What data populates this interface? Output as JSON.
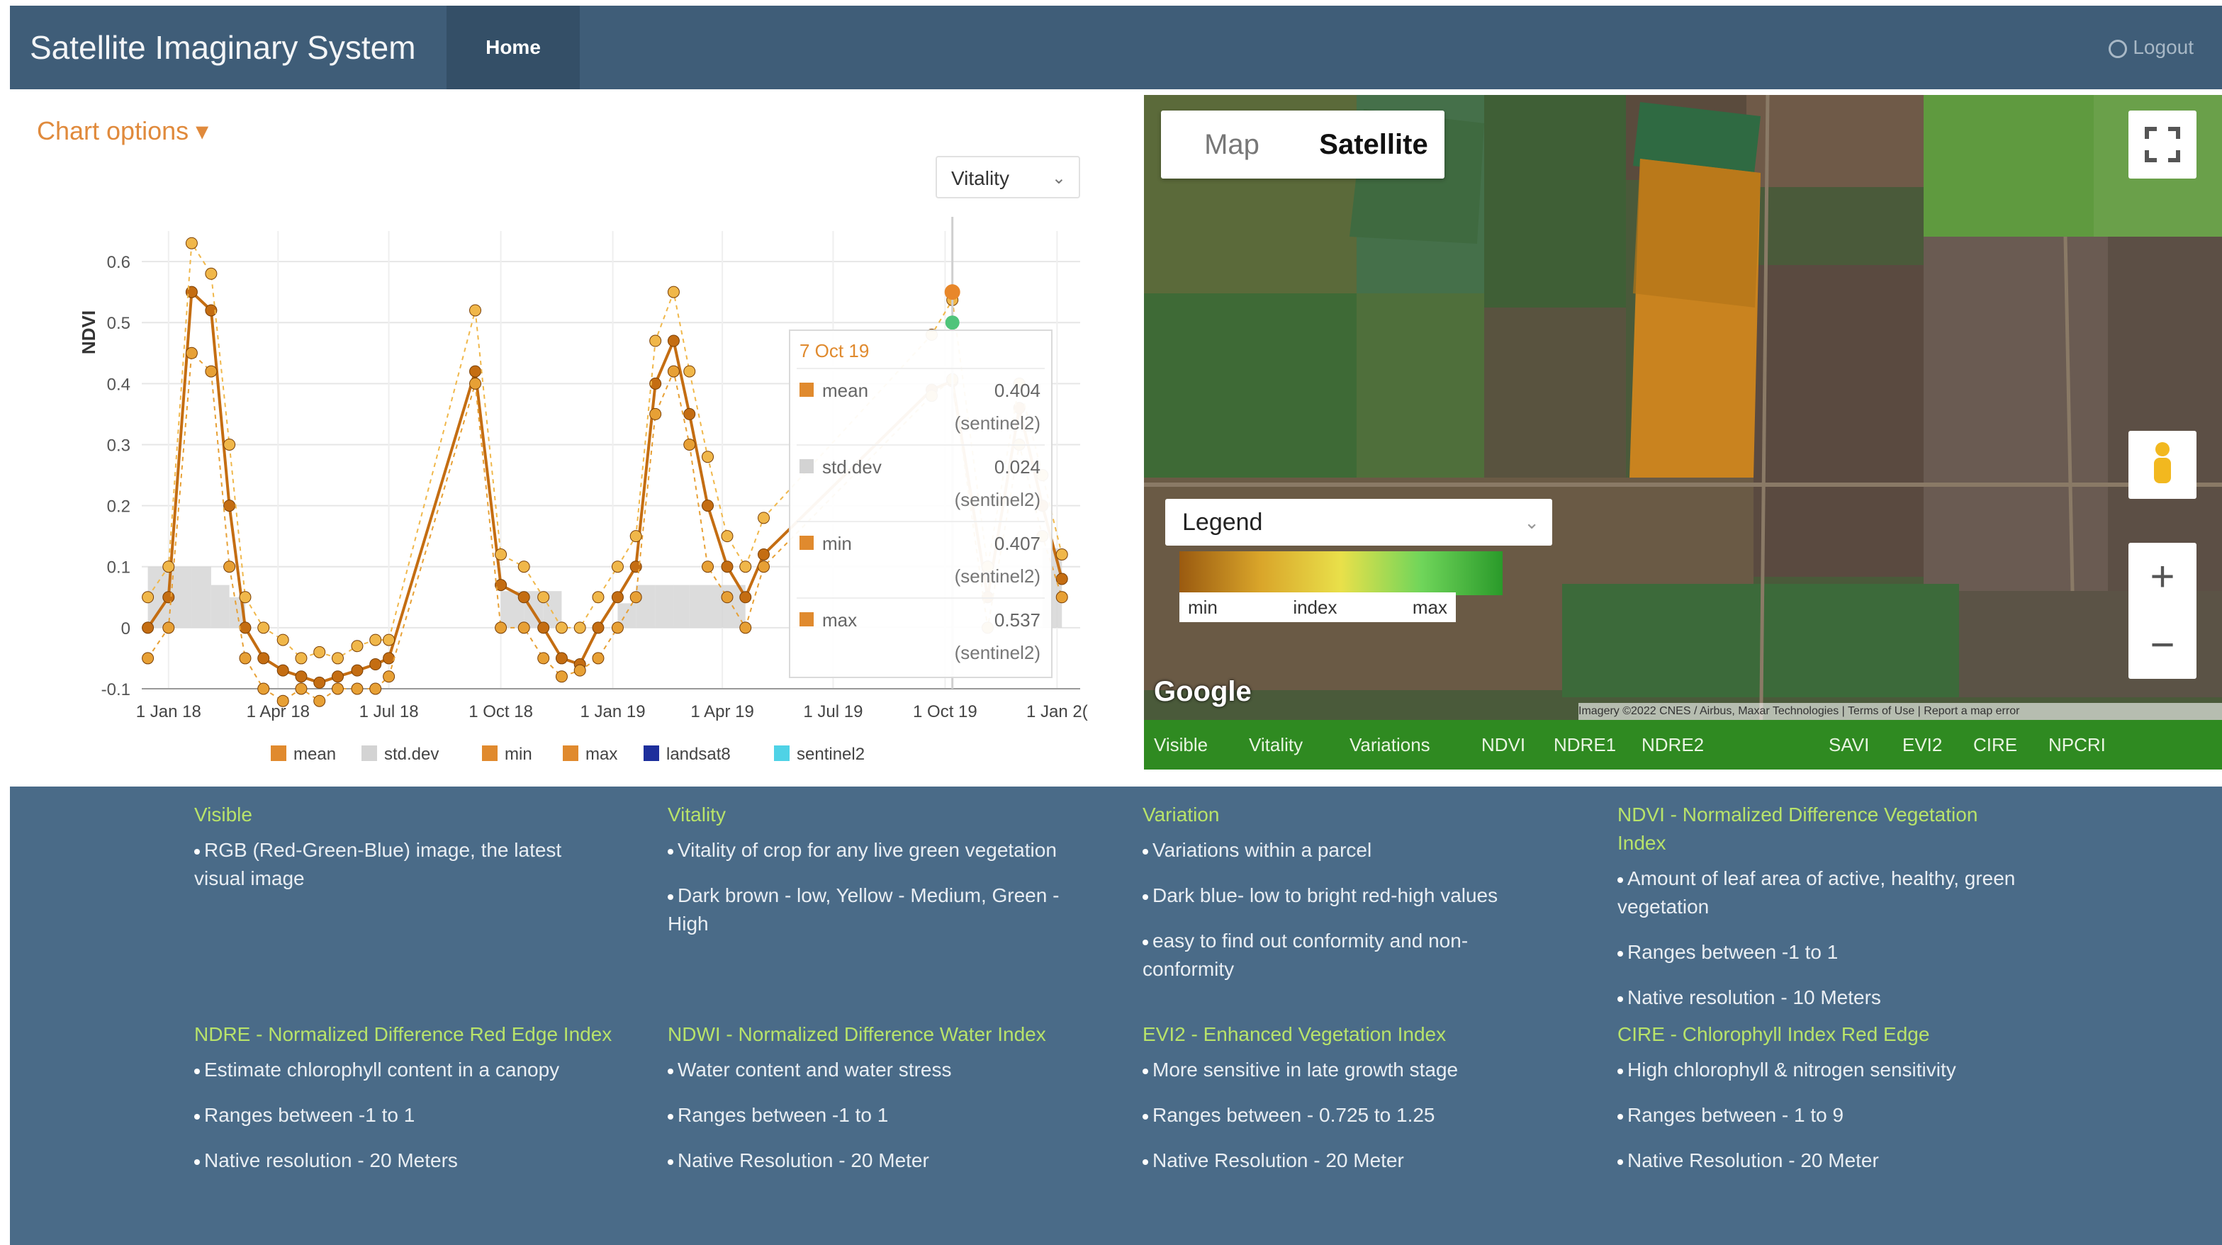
{
  "nav": {
    "brand": "Satellite Imaginary System",
    "home": "Home",
    "logout": "Logout"
  },
  "chart_panel": {
    "options_label": "Chart options ▾",
    "index_select": "Vitality"
  },
  "chart_data": {
    "type": "line",
    "ylabel": "NDVI",
    "yticks": [
      "0.6",
      "0.5",
      "0.4",
      "0.3",
      "0.2",
      "0.1",
      "0",
      "-0.1"
    ],
    "ylim": [
      -0.1,
      0.65
    ],
    "xticks": [
      "1 Jan 18",
      "1 Apr 18",
      "1 Jul 18",
      "1 Oct 18",
      "1 Jan 19",
      "1 Apr 19",
      "1 Jul 19",
      "1 Oct 19",
      "1 Jan 2("
    ],
    "x": [
      "2017-12-15",
      "2018-01-01",
      "2018-01-20",
      "2018-02-05",
      "2018-02-20",
      "2018-03-05",
      "2018-03-20",
      "2018-04-05",
      "2018-04-20",
      "2018-05-05",
      "2018-05-20",
      "2018-06-05",
      "2018-06-20",
      "2018-07-01",
      "2018-09-10",
      "2018-10-01",
      "2018-10-20",
      "2018-11-05",
      "2018-11-20",
      "2018-12-05",
      "2018-12-20",
      "2019-01-05",
      "2019-01-20",
      "2019-02-05",
      "2019-02-20",
      "2019-03-05",
      "2019-03-20",
      "2019-04-05",
      "2019-04-20",
      "2019-05-05",
      "2019-09-20",
      "2019-10-07",
      "2019-11-05",
      "2019-12-01",
      "2019-12-20",
      "2020-01-05"
    ],
    "series": [
      {
        "name": "mean",
        "values": [
          0.0,
          0.05,
          0.55,
          0.52,
          0.2,
          0.0,
          -0.05,
          -0.07,
          -0.08,
          -0.09,
          -0.08,
          -0.07,
          -0.06,
          -0.05,
          0.42,
          0.07,
          0.05,
          0.0,
          -0.05,
          -0.06,
          0.0,
          0.05,
          0.1,
          0.4,
          0.47,
          0.35,
          0.2,
          0.1,
          0.05,
          0.12,
          0.39,
          0.404,
          0.05,
          0.36,
          0.2,
          0.08
        ]
      },
      {
        "name": "min",
        "values": [
          -0.05,
          0.0,
          0.45,
          0.42,
          0.1,
          -0.05,
          -0.1,
          -0.12,
          -0.1,
          -0.12,
          -0.1,
          -0.1,
          -0.1,
          -0.08,
          0.4,
          0.0,
          0.0,
          -0.05,
          -0.08,
          -0.07,
          -0.05,
          0.0,
          0.05,
          0.35,
          0.42,
          0.3,
          0.1,
          0.05,
          0.0,
          0.1,
          0.38,
          0.407,
          0.0,
          0.3,
          0.15,
          0.05
        ]
      },
      {
        "name": "max",
        "values": [
          0.05,
          0.1,
          0.63,
          0.58,
          0.3,
          0.05,
          0.0,
          -0.02,
          -0.05,
          -0.04,
          -0.05,
          -0.03,
          -0.02,
          -0.02,
          0.52,
          0.12,
          0.1,
          0.05,
          0.0,
          0.0,
          0.05,
          0.1,
          0.15,
          0.47,
          0.55,
          0.42,
          0.28,
          0.15,
          0.1,
          0.18,
          0.48,
          0.537,
          0.1,
          0.4,
          0.25,
          0.12
        ]
      }
    ],
    "std_dev_bars": [
      0.1,
      0.1,
      0.1,
      0.07,
      0.05,
      0.0,
      0.0,
      0.0,
      0.0,
      0.0,
      0.0,
      0.0,
      0.0,
      0.0,
      0.0,
      0.06,
      0.06,
      0.06,
      0.0,
      0.0,
      0.0,
      0.04,
      0.07,
      0.07,
      0.07,
      0.07,
      0.07,
      0.07,
      0.0,
      0.0,
      0.0,
      0.0,
      0.0,
      0.0,
      0.13,
      0.13
    ],
    "legend": [
      {
        "label": "mean",
        "color": "#e08a2e"
      },
      {
        "label": "std.dev",
        "color": "#d3d3d3"
      },
      {
        "label": "min",
        "color": "#e08a2e"
      },
      {
        "label": "max",
        "color": "#e08a2e"
      },
      {
        "label": "landsat8",
        "color": "#1d2f9c"
      },
      {
        "label": "sentinel2",
        "color": "#4fd2e6"
      }
    ],
    "tooltip": {
      "date": "7 Oct 19",
      "rows": [
        {
          "label": "mean",
          "value": "0.404",
          "source": "(sentinel2)",
          "color": "#e08a2e"
        },
        {
          "label": "std.dev",
          "value": "0.024",
          "source": "(sentinel2)",
          "color": "#d3d3d3"
        },
        {
          "label": "min",
          "value": "0.407",
          "source": "(sentinel2)",
          "color": "#e08a2e"
        },
        {
          "label": "max",
          "value": "0.537",
          "source": "(sentinel2)",
          "color": "#e08a2e"
        }
      ]
    }
  },
  "map": {
    "toggle": [
      "Map",
      "Satellite"
    ],
    "legend_title": "Legend",
    "legend_labels": [
      "min",
      "index",
      "max"
    ],
    "google": "Google",
    "attribution": "Imagery ©2022 CNES / Airbus, Maxar Technologies | Terms of Use | Report a map error",
    "layers": [
      "Visible",
      "Vitality",
      "Variations",
      "NDVI",
      "NDRE1",
      "NDRE2",
      "SAVI",
      "EVI2",
      "CIRE",
      "NPCRI"
    ]
  },
  "info": [
    {
      "title": "Visible",
      "bullets": [
        "RGB (Red-Green-Blue) image, the latest visual image"
      ]
    },
    {
      "title": "Vitality",
      "bullets": [
        "Vitality of crop for any live green vegetation",
        "Dark brown - low, Yellow - Medium, Green - High"
      ]
    },
    {
      "title": "Variation",
      "bullets": [
        "Variations within a parcel",
        "Dark blue- low to bright red-high values",
        "easy to find out conformity and non-conformity"
      ]
    },
    {
      "title": "NDVI - Normalized Difference Vegetation Index",
      "bullets": [
        "Amount of leaf area of active, healthy, green vegetation",
        "Ranges between -1 to 1",
        "Native resolution - 10 Meters"
      ]
    },
    {
      "title": "NDRE - Normalized Difference Red Edge Index",
      "bullets": [
        "Estimate chlorophyll content in a canopy",
        "Ranges between -1 to 1",
        "Native resolution - 20 Meters"
      ]
    },
    {
      "title": "NDWI - Normalized Difference Water Index",
      "bullets": [
        "Water content and water stress",
        "Ranges between -1 to 1",
        "Native Resolution - 20 Meter"
      ]
    },
    {
      "title": "EVI2 - Enhanced Vegetation Index",
      "bullets": [
        "More sensitive in late growth stage",
        "Ranges between - 0.725 to 1.25",
        "Native Resolution - 20 Meter"
      ]
    },
    {
      "title": "CIRE - Chlorophyll Index Red Edge",
      "bullets": [
        "High chlorophyll & nitrogen sensitivity",
        "Ranges between - 1 to 9",
        "Native Resolution - 20 Meter"
      ]
    }
  ]
}
